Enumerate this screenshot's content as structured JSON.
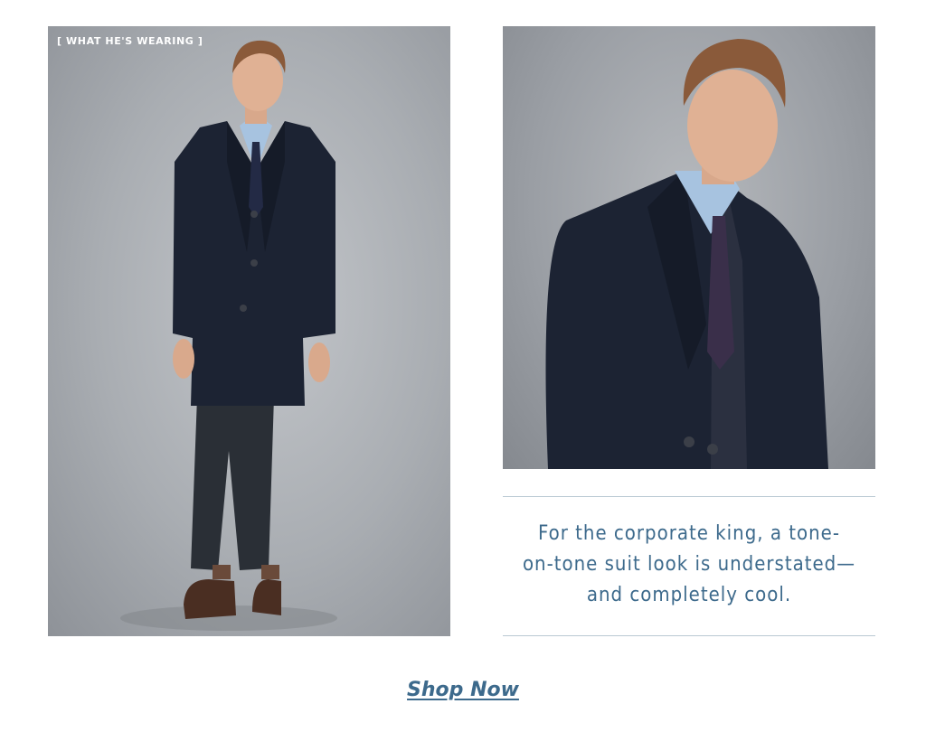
{
  "left_photo": {
    "tag": "[ WHAT HE'S WEARING ]",
    "image_subject": "full-length-model-photo"
  },
  "right_photo": {
    "image_subject": "model-portrait-photo"
  },
  "caption": {
    "lines": [
      "For the corporate king, a tone-",
      "on-tone suit look is understated—",
      "and completely cool."
    ]
  },
  "cta": {
    "label": "Shop Now"
  },
  "colors": {
    "accent": "#3d6a8c",
    "rule": "#b9c9d3",
    "background": "#ffffff"
  }
}
